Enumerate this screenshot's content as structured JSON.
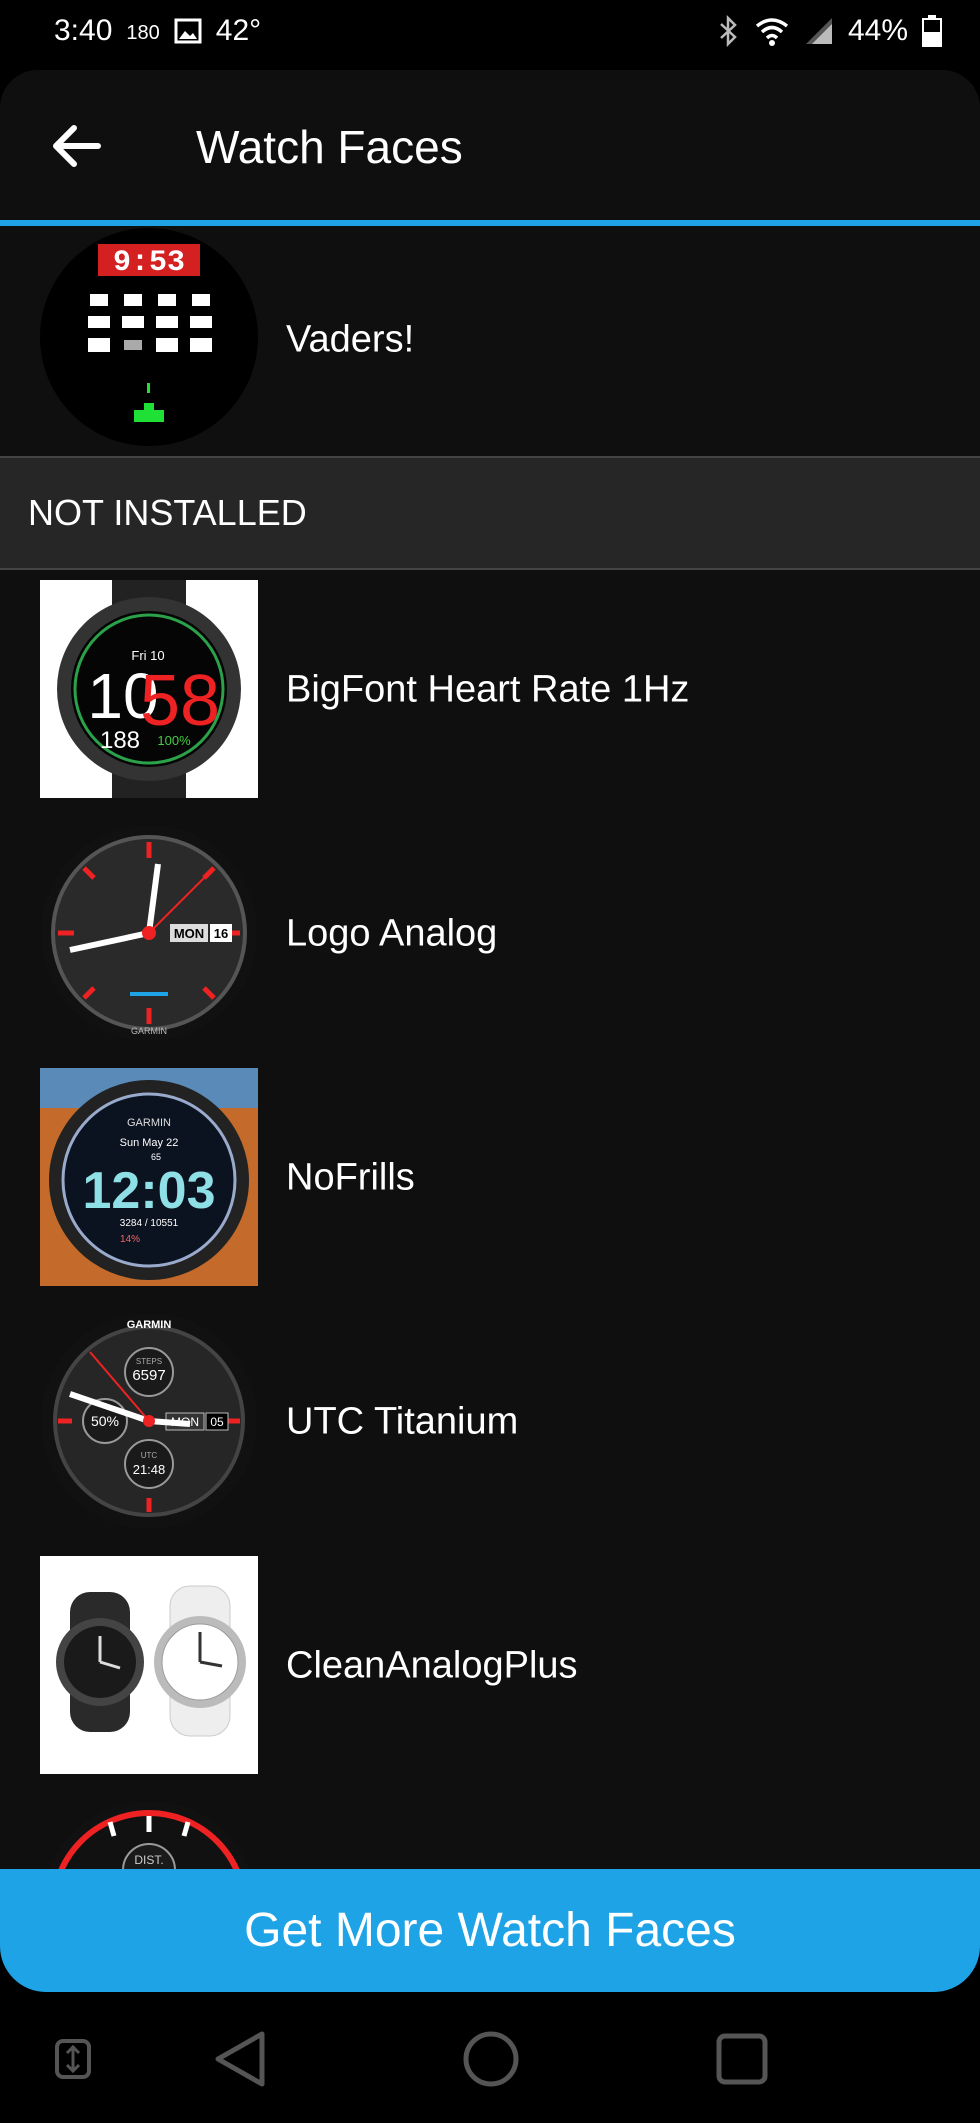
{
  "status_bar": {
    "time": "3:40",
    "extra": "180",
    "temp": "42°",
    "battery": "44%"
  },
  "app_bar": {
    "title": "Watch Faces"
  },
  "installed": [
    {
      "name": "Vaders!",
      "time_shown": "9:53"
    }
  ],
  "section": {
    "not_installed_label": "NOT INSTALLED"
  },
  "not_installed": [
    {
      "name": "BigFont Heart Rate 1Hz",
      "face": {
        "date": "Fri 10",
        "hour": "10",
        "minute": "58",
        "hr": "188",
        "pct": "100%"
      }
    },
    {
      "name": "Logo Analog",
      "face": {
        "day": "MON",
        "date": "16",
        "brand": "GARMIN"
      }
    },
    {
      "name": "NoFrills",
      "face": {
        "brand": "GARMIN",
        "date": "Sun May 22",
        "hr": "65",
        "time": "12:03",
        "steps": "3284 / 10551",
        "battery": "14%"
      }
    },
    {
      "name": "UTC Titanium",
      "face": {
        "brand": "GARMIN",
        "steps_label": "STEPS",
        "steps": "6597",
        "battery": "50%",
        "day": "MON",
        "date": "05",
        "utc_label": "UTC",
        "utc_time": "21:48"
      }
    },
    {
      "name": "CleanAnalogPlus"
    },
    {
      "name": "",
      "face": {
        "dist": "DIST."
      }
    }
  ],
  "cta": {
    "label": "Get More Watch Faces"
  },
  "colors": {
    "accent": "#1ea3e6",
    "background": "#0f0f0f",
    "section_bg": "#262626"
  },
  "nav": [
    "swap-icon",
    "back-triangle-icon",
    "home-circle-icon",
    "recents-square-icon"
  ]
}
